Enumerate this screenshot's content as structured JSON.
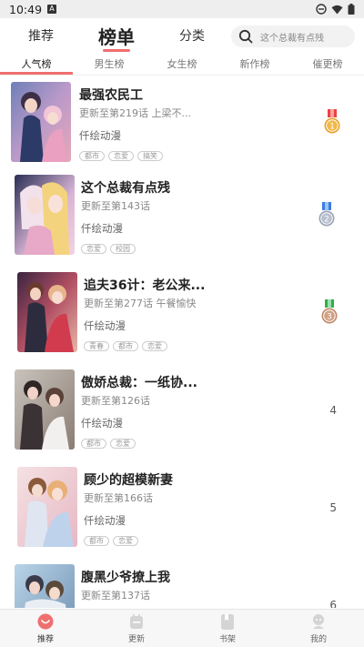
{
  "status_bar": {
    "time": "10:49",
    "notification_icon": "A"
  },
  "top_nav": {
    "tabs": [
      {
        "label": "推荐",
        "active": false
      },
      {
        "label": "榜单",
        "active": true
      },
      {
        "label": "分类",
        "active": false
      }
    ],
    "search": {
      "placeholder": "这个总裁有点残",
      "icon": "search-icon"
    }
  },
  "sub_tabs": [
    {
      "label": "人气榜",
      "active": true
    },
    {
      "label": "男生榜",
      "active": false
    },
    {
      "label": "女生榜",
      "active": false
    },
    {
      "label": "新作榜",
      "active": false
    },
    {
      "label": "催更榜",
      "active": false
    }
  ],
  "ranking": [
    {
      "rank": "1",
      "title": "最强农民工",
      "update": "更新至第219话 上梁不...",
      "author": "仟绘动漫",
      "tags": [
        "都市",
        "恋爱",
        "搞笑"
      ],
      "medal": "gold"
    },
    {
      "rank": "2",
      "title": "这个总裁有点残",
      "update": "更新至第143话",
      "author": "仟绘动漫",
      "tags": [
        "恋爱",
        "校园"
      ],
      "medal": "silver"
    },
    {
      "rank": "3",
      "title": "追夫36计：老公来...",
      "update": "更新至第277话 午餐愉快",
      "author": "仟绘动漫",
      "tags": [
        "青春",
        "都市",
        "恋爱"
      ],
      "medal": "bronze"
    },
    {
      "rank": "4",
      "title": "傲娇总裁：一纸协...",
      "update": "更新至第126话",
      "author": "仟绘动漫",
      "tags": [
        "都市",
        "恋爱"
      ],
      "medal": ""
    },
    {
      "rank": "5",
      "title": "顾少的超模新妻",
      "update": "更新至第166话",
      "author": "仟绘动漫",
      "tags": [
        "都市",
        "恋爱"
      ],
      "medal": ""
    },
    {
      "rank": "6",
      "title": "腹黑少爷撩上我",
      "update": "更新至第137话",
      "author": "",
      "tags": [],
      "medal": ""
    }
  ],
  "bottom_nav": [
    {
      "label": "推荐",
      "icon": "recommend-icon",
      "active": true
    },
    {
      "label": "更新",
      "icon": "update-icon",
      "active": false
    },
    {
      "label": "书架",
      "icon": "bookshelf-icon",
      "active": false
    },
    {
      "label": "我的",
      "icon": "profile-icon",
      "active": false
    }
  ],
  "colors": {
    "accent": "#ef6f6f",
    "gold": "#e8a22a",
    "silver": "#9aa3b5",
    "bronze": "#c08a6c"
  }
}
